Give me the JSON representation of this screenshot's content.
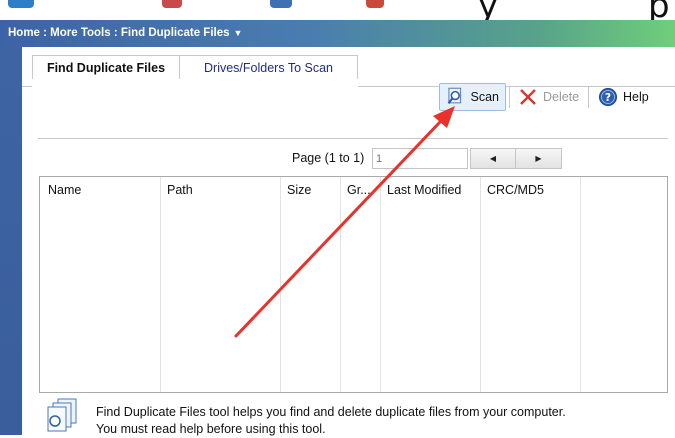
{
  "breadcrumb": {
    "text": "Home : More Tools : Find Duplicate Files",
    "dropdown_arrow": "▼"
  },
  "tabs": [
    {
      "label": "Find Duplicate Files",
      "active": true
    },
    {
      "label": "Drives/Folders To Scan",
      "active": false
    }
  ],
  "toolbar": {
    "scan_label": "Scan",
    "delete_label": "Delete",
    "help_label": "Help"
  },
  "pager": {
    "label": "Page (1 to 1)",
    "page_value": "1",
    "prev_glyph": "◀",
    "next_glyph": "▶"
  },
  "grid": {
    "columns": [
      "Name",
      "Path",
      "Size",
      "Gr...",
      "Last Modified",
      "CRC/MD5"
    ]
  },
  "info": {
    "line1": "Find Duplicate Files tool helps you find and delete duplicate files from your computer.",
    "line2": "You must read help before using this tool."
  },
  "colors": {
    "breadcrumb_start": "#3d63a6",
    "breadcrumb_end": "#6fcf7a",
    "annotation_arrow": "#e8322b",
    "tab_link": "#1f2d8c"
  },
  "icons": {
    "scan": "magnifier-document-icon",
    "delete": "red-x-icon",
    "help": "question-circle-icon",
    "info": "duplicate-documents-icon"
  }
}
